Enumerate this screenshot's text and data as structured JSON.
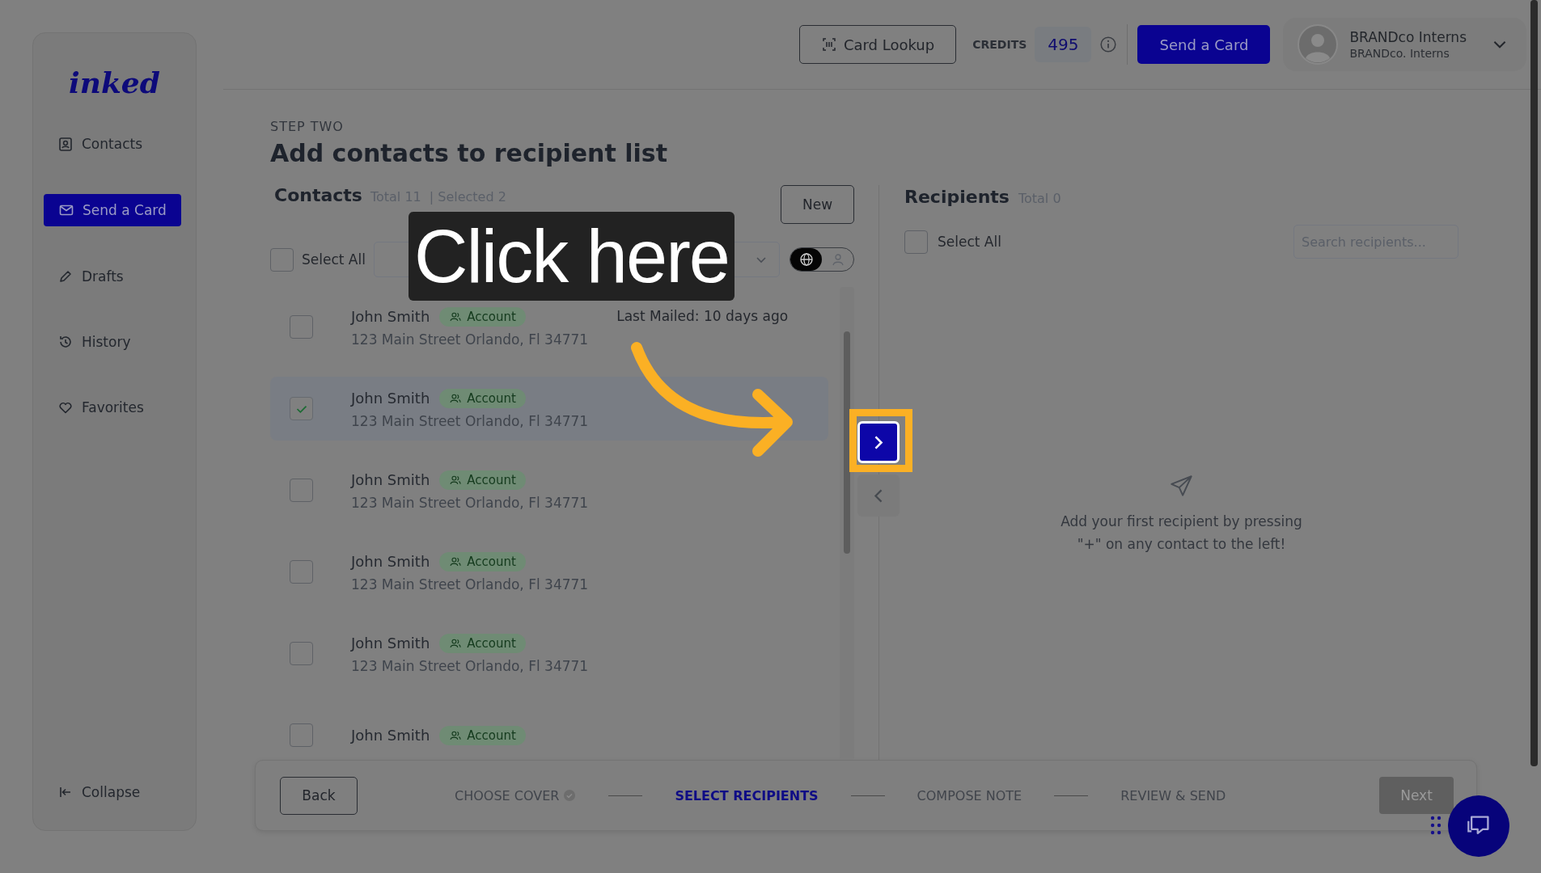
{
  "sidebar": {
    "logo": "inked",
    "items": [
      {
        "label": "Contacts",
        "kind": "contacts",
        "selected": false
      },
      {
        "label": "Send a Card",
        "kind": "mail",
        "selected": true
      },
      {
        "label": "Drafts",
        "kind": "pencil",
        "selected": false
      },
      {
        "label": "History",
        "kind": "history",
        "selected": false
      },
      {
        "label": "Favorites",
        "kind": "heart",
        "selected": false
      }
    ],
    "collapse": "Collapse"
  },
  "topbar": {
    "card_lookup": "Card Lookup",
    "credits_label": "CREDITS",
    "credits": "495",
    "send_button": "Send a Card",
    "user": {
      "name": "BRANDco Interns",
      "org": "BRANDco. Interns"
    }
  },
  "step": {
    "label": "STEP TWO",
    "title": "Add contacts to recipient list"
  },
  "contacts": {
    "title": "Contacts",
    "total": "Total 11",
    "selected_count": "| Selected 2",
    "new_button": "New",
    "select_all": {
      "label": "Select All",
      "checked": false
    },
    "view_modes": [
      {
        "kind": "globe",
        "selected": true
      },
      {
        "kind": "person",
        "selected": false
      }
    ],
    "rows": [
      {
        "name": "John Smith",
        "tag": "Account",
        "address": "123 Main Street Orlando, Fl 34771",
        "checked": false,
        "last_mailed": "Last Mailed: 10 days ago"
      },
      {
        "name": "John Smith",
        "tag": "Account",
        "address": "123 Main Street Orlando, Fl 34771",
        "checked": true
      },
      {
        "name": "John Smith",
        "tag": "Account",
        "address": "123 Main Street Orlando, Fl 34771",
        "checked": false
      },
      {
        "name": "John Smith",
        "tag": "Account",
        "address": "123 Main Street Orlando, Fl 34771",
        "checked": false
      },
      {
        "name": "John Smith",
        "tag": "Account",
        "address": "123 Main Street Orlando, Fl 34771",
        "checked": false
      },
      {
        "name": "John Smith",
        "tag": "Account",
        "checked": false
      }
    ]
  },
  "recipients": {
    "title": "Recipients",
    "total": "Total 0",
    "select_all": {
      "label": "Select All",
      "checked": false
    },
    "search_placeholder": "Search recipients...",
    "empty_text": "Add your first recipient by pressing \"+\" on any contact to the left!"
  },
  "footer": {
    "back": "Back",
    "steps": [
      {
        "label": "CHOOSE COVER",
        "done": true,
        "selected": false
      },
      {
        "label": "SELECT RECIPIENTS",
        "done": false,
        "selected": true
      },
      {
        "label": "COMPOSE NOTE",
        "done": false,
        "selected": false
      },
      {
        "label": "REVIEW & SEND",
        "done": false,
        "selected": false
      }
    ],
    "next": {
      "label": "Next",
      "disabled": true
    }
  },
  "tour": {
    "callout": "Click here"
  }
}
